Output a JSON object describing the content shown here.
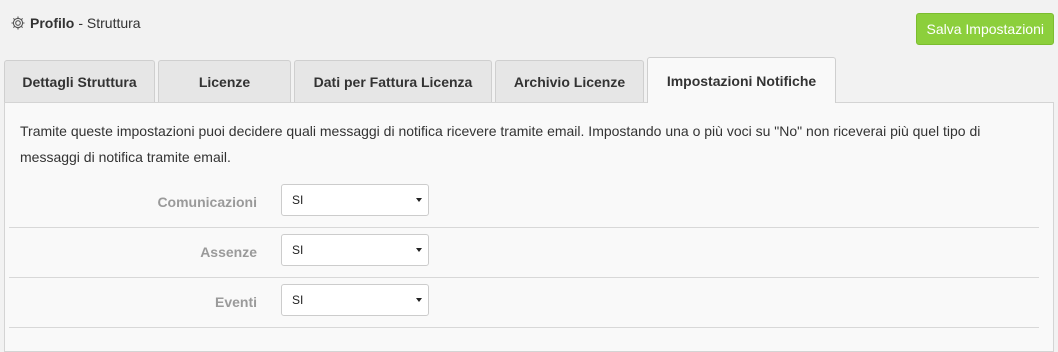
{
  "header": {
    "icon": "gear-icon",
    "title": "Profilo",
    "subtitle": "- Struttura"
  },
  "actions": {
    "save_label": "Salva Impostazioni",
    "save_color": "#8ccf3c"
  },
  "tabs": [
    {
      "label": "Dettagli Struttura",
      "active": false
    },
    {
      "label": "Licenze",
      "active": false
    },
    {
      "label": "Dati per Fattura Licenza",
      "active": false
    },
    {
      "label": "Archivio Licenze",
      "active": false
    },
    {
      "label": "Impostazioni Notifiche",
      "active": true
    }
  ],
  "panel": {
    "description": "Tramite queste impostazioni puoi decidere quali messaggi di notifica ricevere tramite email. Impostando una o più voci su \"No\" non riceverai più quel tipo di messaggi di notifica tramite email.",
    "settings": [
      {
        "label": "Comunicazioni",
        "value": "SI"
      },
      {
        "label": "Assenze",
        "value": "SI"
      },
      {
        "label": "Eventi",
        "value": "SI"
      }
    ]
  }
}
